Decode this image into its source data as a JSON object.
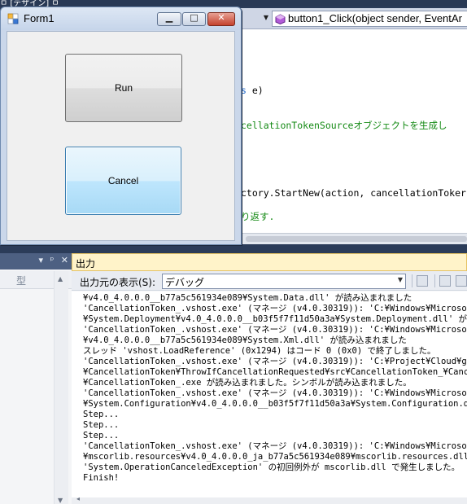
{
  "ide": {
    "top_fragment": "ㅁ [デザイン] ㅁ",
    "method_dropdown": "button1_Click(object sender, EventAr",
    "code_lines": [
      {
        "kind": "kw",
        "pre": "",
        "kw": "s",
        "post": " e)"
      },
      {
        "kind": "cm",
        "text": "cellationTokenSourceオブジェクトを生成し"
      },
      {
        "kind": "plain",
        "text": "ctory.StartNew(action, cancellationToker"
      },
      {
        "kind": "cm",
        "text": "り返す."
      }
    ],
    "tool_window": {
      "buttons": [
        "▾",
        "ᵖ",
        "✕"
      ],
      "column_header": "型"
    }
  },
  "output": {
    "title": "出力",
    "source_label": "出力元の表示(S):",
    "source_value": "デバッグ",
    "lines": [
      "¥v4.0_4.0.0.0__b77a5c561934e089¥System.Data.dll' が読み込まれました",
      "'CancellationToken_.vshost.exe' (マネージ (v4.0.30319)): 'C:¥Windows¥Microsoft.",
      "¥System.Deployment¥v4.0_4.0.0.0__b03f5f7f11d50a3a¥System.Deployment.dll' が読み",
      "'CancellationToken_.vshost.exe' (マネージ (v4.0.30319)): 'C:¥Windows¥Microsoft.",
      "¥v4.0_4.0.0.0__b77a5c561934e089¥System.Xml.dll' が読み込まれました",
      "スレッド 'vshost.LoadReference' (0x1294) はコード 0 (0x0) で終了しました。",
      "'CancellationToken_.vshost.exe' (マネージ (v4.0.30319)): 'C:¥Project¥Cloud¥gith",
      "¥CancellationToken¥ThrowIfCancellationRequested¥src¥CancellationToken_¥Cancella",
      "¥CancellationToken_.exe が読み込まれました。シンボルが読み込まれました。",
      "'CancellationToken_.vshost.exe' (マネージ (v4.0.30319)): 'C:¥Windows¥Microsoft.",
      "¥System.Configuration¥v4.0_4.0.0.0__b03f5f7f11d50a3a¥System.Configuration.dll'",
      "Step...",
      "Step...",
      "Step...",
      "'CancellationToken_.vshost.exe' (マネージ (v4.0.30319)): 'C:¥Windows¥Microsoft.",
      "¥mscorlib.resources¥v4.0_4.0.0.0_ja_b77a5c561934e089¥mscorlib.resources.dll' が",
      "'System.OperationCanceledException' の初回例外が mscorlib.dll で発生しました。",
      "Finish!"
    ]
  },
  "form1": {
    "title": "Form1",
    "run_label": "Run",
    "cancel_label": "Cancel"
  },
  "colors": {
    "ide_background": "#2b3c59",
    "output_title_bg": "#fff3c9",
    "keyword_blue": "#1a64c9",
    "comment_green": "#148a14",
    "close_red": "#c4422e",
    "focused_button_border": "#3c7fb1"
  }
}
